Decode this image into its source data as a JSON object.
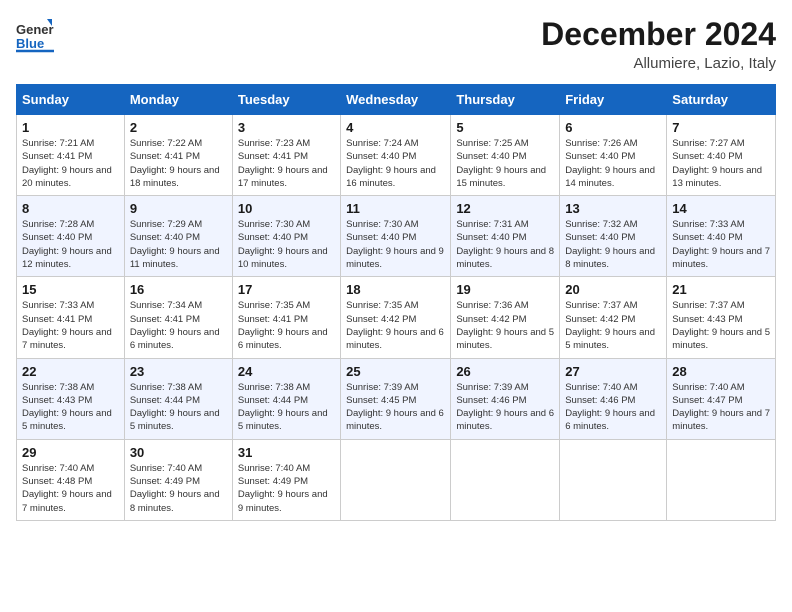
{
  "header": {
    "logo_general": "General",
    "logo_blue": "Blue",
    "month_title": "December 2024",
    "location": "Allumiere, Lazio, Italy"
  },
  "weekdays": [
    "Sunday",
    "Monday",
    "Tuesday",
    "Wednesday",
    "Thursday",
    "Friday",
    "Saturday"
  ],
  "weeks": [
    [
      {
        "day": "1",
        "sunrise": "Sunrise: 7:21 AM",
        "sunset": "Sunset: 4:41 PM",
        "daylight": "Daylight: 9 hours and 20 minutes."
      },
      {
        "day": "2",
        "sunrise": "Sunrise: 7:22 AM",
        "sunset": "Sunset: 4:41 PM",
        "daylight": "Daylight: 9 hours and 18 minutes."
      },
      {
        "day": "3",
        "sunrise": "Sunrise: 7:23 AM",
        "sunset": "Sunset: 4:41 PM",
        "daylight": "Daylight: 9 hours and 17 minutes."
      },
      {
        "day": "4",
        "sunrise": "Sunrise: 7:24 AM",
        "sunset": "Sunset: 4:40 PM",
        "daylight": "Daylight: 9 hours and 16 minutes."
      },
      {
        "day": "5",
        "sunrise": "Sunrise: 7:25 AM",
        "sunset": "Sunset: 4:40 PM",
        "daylight": "Daylight: 9 hours and 15 minutes."
      },
      {
        "day": "6",
        "sunrise": "Sunrise: 7:26 AM",
        "sunset": "Sunset: 4:40 PM",
        "daylight": "Daylight: 9 hours and 14 minutes."
      },
      {
        "day": "7",
        "sunrise": "Sunrise: 7:27 AM",
        "sunset": "Sunset: 4:40 PM",
        "daylight": "Daylight: 9 hours and 13 minutes."
      }
    ],
    [
      {
        "day": "8",
        "sunrise": "Sunrise: 7:28 AM",
        "sunset": "Sunset: 4:40 PM",
        "daylight": "Daylight: 9 hours and 12 minutes."
      },
      {
        "day": "9",
        "sunrise": "Sunrise: 7:29 AM",
        "sunset": "Sunset: 4:40 PM",
        "daylight": "Daylight: 9 hours and 11 minutes."
      },
      {
        "day": "10",
        "sunrise": "Sunrise: 7:30 AM",
        "sunset": "Sunset: 4:40 PM",
        "daylight": "Daylight: 9 hours and 10 minutes."
      },
      {
        "day": "11",
        "sunrise": "Sunrise: 7:30 AM",
        "sunset": "Sunset: 4:40 PM",
        "daylight": "Daylight: 9 hours and 9 minutes."
      },
      {
        "day": "12",
        "sunrise": "Sunrise: 7:31 AM",
        "sunset": "Sunset: 4:40 PM",
        "daylight": "Daylight: 9 hours and 8 minutes."
      },
      {
        "day": "13",
        "sunrise": "Sunrise: 7:32 AM",
        "sunset": "Sunset: 4:40 PM",
        "daylight": "Daylight: 9 hours and 8 minutes."
      },
      {
        "day": "14",
        "sunrise": "Sunrise: 7:33 AM",
        "sunset": "Sunset: 4:40 PM",
        "daylight": "Daylight: 9 hours and 7 minutes."
      }
    ],
    [
      {
        "day": "15",
        "sunrise": "Sunrise: 7:33 AM",
        "sunset": "Sunset: 4:41 PM",
        "daylight": "Daylight: 9 hours and 7 minutes."
      },
      {
        "day": "16",
        "sunrise": "Sunrise: 7:34 AM",
        "sunset": "Sunset: 4:41 PM",
        "daylight": "Daylight: 9 hours and 6 minutes."
      },
      {
        "day": "17",
        "sunrise": "Sunrise: 7:35 AM",
        "sunset": "Sunset: 4:41 PM",
        "daylight": "Daylight: 9 hours and 6 minutes."
      },
      {
        "day": "18",
        "sunrise": "Sunrise: 7:35 AM",
        "sunset": "Sunset: 4:42 PM",
        "daylight": "Daylight: 9 hours and 6 minutes."
      },
      {
        "day": "19",
        "sunrise": "Sunrise: 7:36 AM",
        "sunset": "Sunset: 4:42 PM",
        "daylight": "Daylight: 9 hours and 5 minutes."
      },
      {
        "day": "20",
        "sunrise": "Sunrise: 7:37 AM",
        "sunset": "Sunset: 4:42 PM",
        "daylight": "Daylight: 9 hours and 5 minutes."
      },
      {
        "day": "21",
        "sunrise": "Sunrise: 7:37 AM",
        "sunset": "Sunset: 4:43 PM",
        "daylight": "Daylight: 9 hours and 5 minutes."
      }
    ],
    [
      {
        "day": "22",
        "sunrise": "Sunrise: 7:38 AM",
        "sunset": "Sunset: 4:43 PM",
        "daylight": "Daylight: 9 hours and 5 minutes."
      },
      {
        "day": "23",
        "sunrise": "Sunrise: 7:38 AM",
        "sunset": "Sunset: 4:44 PM",
        "daylight": "Daylight: 9 hours and 5 minutes."
      },
      {
        "day": "24",
        "sunrise": "Sunrise: 7:38 AM",
        "sunset": "Sunset: 4:44 PM",
        "daylight": "Daylight: 9 hours and 5 minutes."
      },
      {
        "day": "25",
        "sunrise": "Sunrise: 7:39 AM",
        "sunset": "Sunset: 4:45 PM",
        "daylight": "Daylight: 9 hours and 6 minutes."
      },
      {
        "day": "26",
        "sunrise": "Sunrise: 7:39 AM",
        "sunset": "Sunset: 4:46 PM",
        "daylight": "Daylight: 9 hours and 6 minutes."
      },
      {
        "day": "27",
        "sunrise": "Sunrise: 7:40 AM",
        "sunset": "Sunset: 4:46 PM",
        "daylight": "Daylight: 9 hours and 6 minutes."
      },
      {
        "day": "28",
        "sunrise": "Sunrise: 7:40 AM",
        "sunset": "Sunset: 4:47 PM",
        "daylight": "Daylight: 9 hours and 7 minutes."
      }
    ],
    [
      {
        "day": "29",
        "sunrise": "Sunrise: 7:40 AM",
        "sunset": "Sunset: 4:48 PM",
        "daylight": "Daylight: 9 hours and 7 minutes."
      },
      {
        "day": "30",
        "sunrise": "Sunrise: 7:40 AM",
        "sunset": "Sunset: 4:49 PM",
        "daylight": "Daylight: 9 hours and 8 minutes."
      },
      {
        "day": "31",
        "sunrise": "Sunrise: 7:40 AM",
        "sunset": "Sunset: 4:49 PM",
        "daylight": "Daylight: 9 hours and 9 minutes."
      },
      null,
      null,
      null,
      null
    ]
  ]
}
